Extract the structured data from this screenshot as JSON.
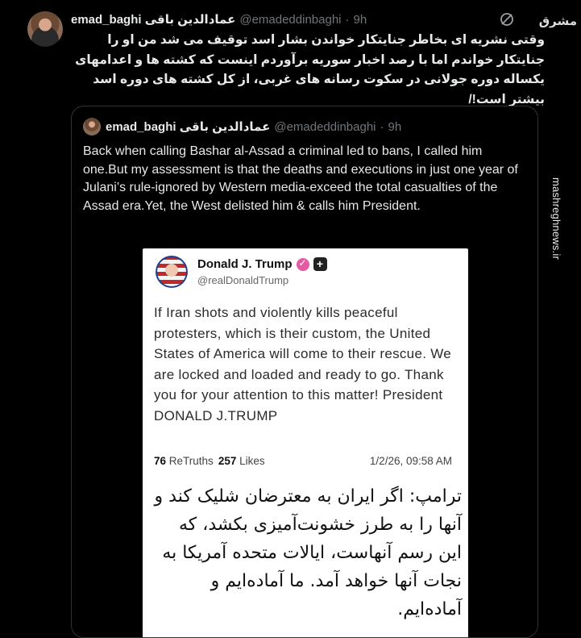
{
  "tweet": {
    "name": "emad_baghi عمادالدین باقی",
    "handle": "@emadeddinbaghi",
    "separator": "·",
    "time": "9h",
    "text": "وقتی نشریه ای بخاطر جنایتکار خواندن بشار اسد توقیف می شد من او را جنایتکار خواندم اما با رصد اخبار سوریه برآوردم اینست که کشته ها و اعدامهای یکساله دوره جولانی در سکوت رسانه های غربی، از کل کشته های دوره اسد بیشتر است!/"
  },
  "watermark": {
    "logo": "مشرق",
    "url": "mashreghnews.ir"
  },
  "quote": {
    "name": "emad_baghi عمادالدین باقی",
    "handle": "@emadeddinbaghi",
    "separator": "·",
    "time": "9h",
    "text": "Back when calling Bashar al-Assad a criminal led to bans, I called him one.But my assessment is that the deaths and executions in just one year of Julani’s rule-ignored by Western media-exceed the total casualties of the Assad era.Yet, the West delisted him & calls him President."
  },
  "embed": {
    "name": "Donald J. Trump",
    "handle": "@realDonaldTrump",
    "plus": "+",
    "body": "If Iran shots and violently kills peaceful protesters, which is their custom, the United States of America will come to their rescue. We are locked and loaded and ready to go. Thank you for your attention to this matter! President DONALD J.TRUMP",
    "retruths_count": "76",
    "retruths_label": "ReTruths",
    "likes_count": "257",
    "likes_label": "Likes",
    "date": "1/2/26, 09:58 AM",
    "translation": "ترامپ: اگر ایران به معترضان شلیک کند و آنها را به طرز خشونت‌آمیزی بکشد، که این رسم آنهاست، ایالات متحده آمریکا به نجات آنها خواهد آمد. ما آماده‌ایم و آماده‌ایم."
  },
  "icons": {
    "grok": "grok-icon",
    "verified": "verified-badge-icon"
  }
}
